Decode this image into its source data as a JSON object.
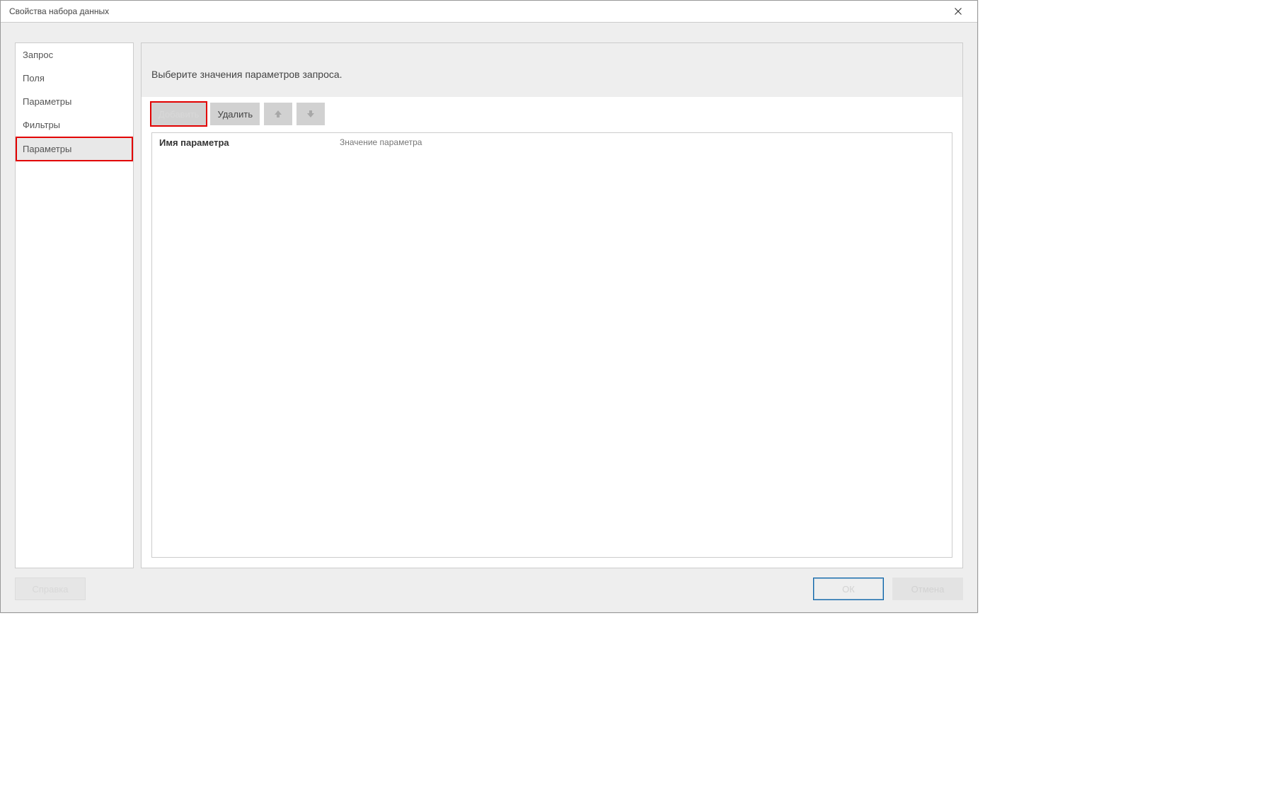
{
  "dialog": {
    "title": "Свойства набора данных"
  },
  "sidebar": {
    "items": [
      {
        "label": "Запрос"
      },
      {
        "label": "Поля"
      },
      {
        "label": "Параметры"
      },
      {
        "label": "Фильтры"
      },
      {
        "label": "Параметры"
      }
    ]
  },
  "main": {
    "header_text": "Выберите значения параметров запроса.",
    "toolbar": {
      "add_label": "Добавить",
      "delete_label": "Удалить"
    },
    "grid": {
      "col_name": "Имя параметра",
      "col_value": "Значение параметра"
    }
  },
  "footer": {
    "help_label": "Справка",
    "ok_label": "ОК",
    "cancel_label": "Отмена"
  }
}
